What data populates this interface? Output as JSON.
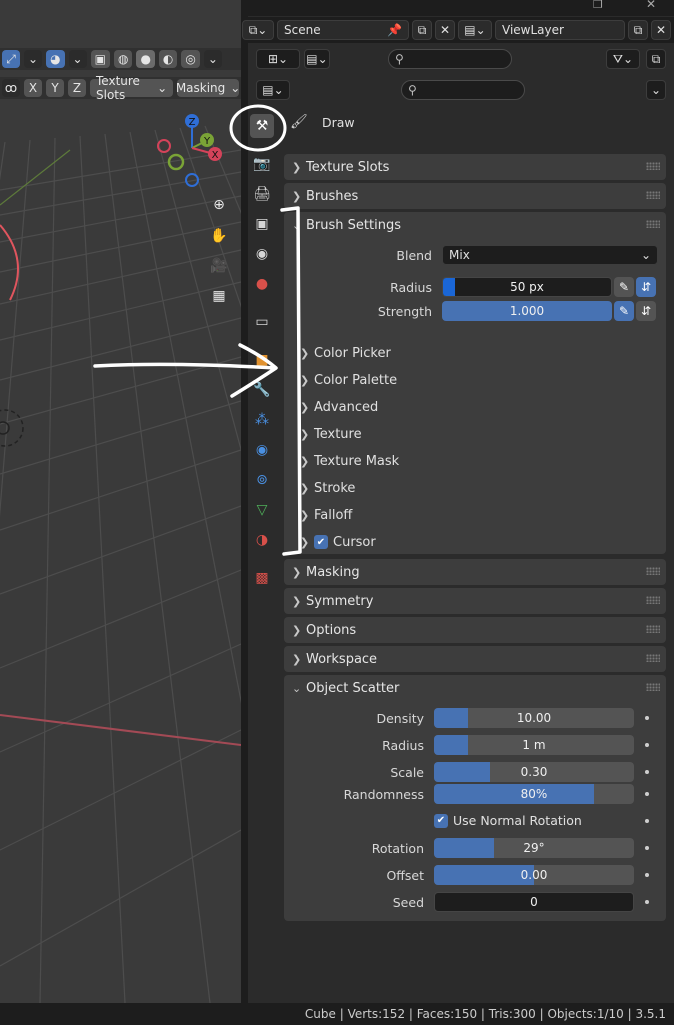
{
  "titlebar": {
    "restore_icon": "restore-icon",
    "close_icon": "close-icon"
  },
  "viewport": {
    "header": {
      "axis_x": "X",
      "axis_y": "Y",
      "axis_z": "Z",
      "texture_slots": "Texture Slots",
      "masking": "Masking"
    },
    "gizmo": {
      "z": "Z",
      "y": "Y",
      "x": "X"
    }
  },
  "top_header": {
    "scene": "Scene",
    "view_layer": "ViewLayer"
  },
  "tool_header": {
    "tool_name": "Draw"
  },
  "panels": {
    "texture_slots": "Texture Slots",
    "brushes": "Brushes",
    "brush_settings": "Brush Settings",
    "blend_label": "Blend",
    "blend_value": "Mix",
    "radius_label": "Radius",
    "radius_value": "50 px",
    "strength_label": "Strength",
    "strength_value": "1.000",
    "sub": [
      "Color Picker",
      "Color Palette",
      "Advanced",
      "Texture",
      "Texture Mask",
      "Stroke",
      "Falloff"
    ],
    "cursor": "Cursor",
    "masking": "Masking",
    "symmetry": "Symmetry",
    "options": "Options",
    "workspace": "Workspace",
    "object_scatter": "Object Scatter"
  },
  "scatter": {
    "density_label": "Density",
    "density_value": "10.00",
    "density_fill": 0.17,
    "radius_label": "Radius",
    "radius_value": "1 m",
    "radius_fill": 0.17,
    "scale_label": "Scale",
    "scale_value": "0.30",
    "scale_fill": 0.28,
    "randomness_label": "Randomness",
    "randomness_value": "80%",
    "randomness_fill": 0.8,
    "normal_rotation": "Use Normal Rotation",
    "rotation_label": "Rotation",
    "rotation_value": "29°",
    "rotation_fill": 0.3,
    "offset_label": "Offset",
    "offset_value": "0.00",
    "offset_fill": 0.5,
    "seed_label": "Seed",
    "seed_value": "0"
  },
  "status": "Cube | Verts:152 | Faces:150 | Tris:300 | Objects:1/10 | 3.5.1",
  "colors": {
    "accent": "#4772b3",
    "panel": "#3d3d3d",
    "background": "#2b2b2b"
  }
}
